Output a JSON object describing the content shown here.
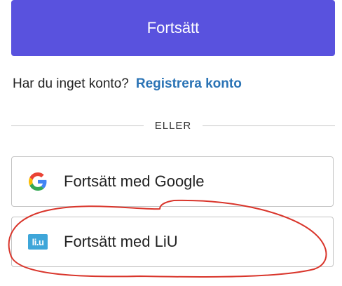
{
  "primary_button": {
    "label": "Fortsätt"
  },
  "signup": {
    "prompt": "Har du inget konto?",
    "link_label": "Registrera konto"
  },
  "divider": {
    "label": "ELLER"
  },
  "providers": [
    {
      "label": "Fortsätt med Google",
      "icon": "google-icon"
    },
    {
      "label": "Fortsätt med LiU",
      "icon": "liu-logo-icon",
      "icon_text": "li.u"
    }
  ],
  "colors": {
    "primary": "#5952DE",
    "link": "#2A73B5",
    "annotation": "#D9352B",
    "liu_brand": "#3EA6D9"
  }
}
